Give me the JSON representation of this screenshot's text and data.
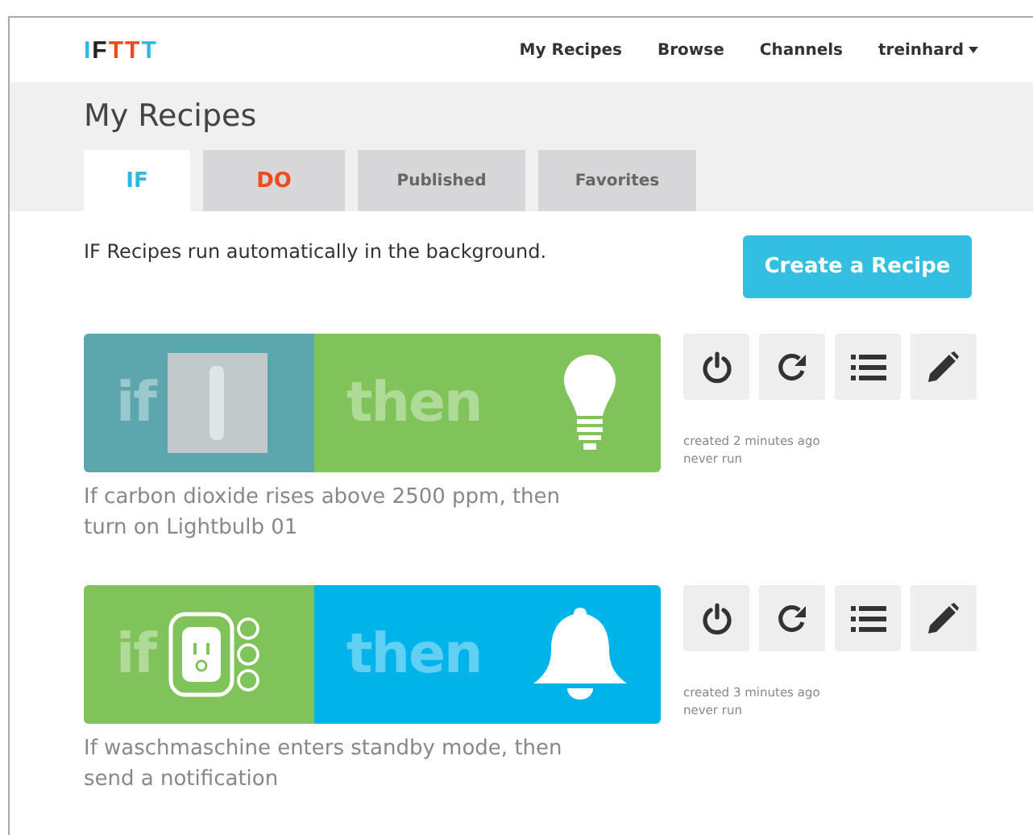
{
  "logo": "IFTTT",
  "nav": [
    {
      "label": "My Recipes"
    },
    {
      "label": "Browse"
    },
    {
      "label": "Channels"
    },
    {
      "label": "treinhard",
      "kind": "dropdown"
    }
  ],
  "title": "My Recipes",
  "tabs": [
    {
      "label": "IF",
      "selected": true,
      "color": "#2fb9e0"
    },
    {
      "label": "DO",
      "selected": false,
      "color": "#ee4a1c"
    },
    {
      "label": "Published",
      "selected": false
    },
    {
      "label": "Favorites",
      "selected": false
    }
  ],
  "intro": "IF Recipes run automatically in the background.",
  "create_button": "Create a Recipe",
  "recipes": [
    {
      "if_word": "if",
      "then_word": "then",
      "trigger": {
        "kind": "switch",
        "color": "#5ca6ad"
      },
      "action": {
        "kind": "bulb",
        "color": "#80c35a"
      },
      "created": "created 2 minutes ago",
      "last_run": "never run",
      "description": "If carbon dioxide rises above 2500 ppm, then turn on Lightbulb 01"
    },
    {
      "if_word": "if",
      "then_word": "then",
      "trigger": {
        "kind": "plug",
        "color": "#80c35a"
      },
      "action": {
        "kind": "bell",
        "color": "#00b4ea"
      },
      "created": "created 3 minutes ago",
      "last_run": "never run",
      "description": "If waschmaschine enters standby mode, then send a notification"
    }
  ]
}
